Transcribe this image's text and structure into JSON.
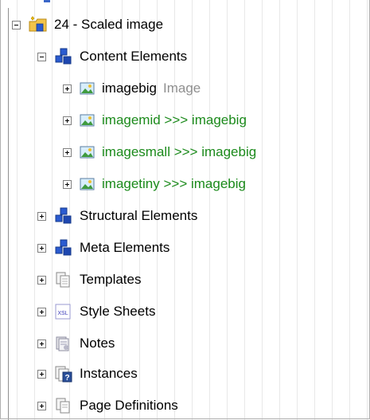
{
  "tree": {
    "root": {
      "label": "24 - Scaled image"
    },
    "content_elements": {
      "label": "Content Elements"
    },
    "images": [
      {
        "name": "imagebig",
        "type": "Image",
        "style": "normal"
      },
      {
        "name": "imagemid >>> imagebig",
        "type": "",
        "style": "green"
      },
      {
        "name": "imagesmall >>> imagebig",
        "type": "",
        "style": "green"
      },
      {
        "name": "imagetiny >>> imagebig",
        "type": "",
        "style": "green"
      }
    ],
    "structural_elements": {
      "label": "Structural Elements"
    },
    "meta_elements": {
      "label": "Meta Elements"
    },
    "templates": {
      "label": "Templates"
    },
    "style_sheets": {
      "label": "Style Sheets",
      "icon_text": "XSL"
    },
    "notes": {
      "label": "Notes"
    },
    "instances": {
      "label": "Instances"
    },
    "page_definitions": {
      "label": "Page Definitions"
    }
  },
  "colors": {
    "link_green": "#1b8a1b",
    "type_gray": "#8f8f8f",
    "cube_blue": "#2a5bd0"
  }
}
